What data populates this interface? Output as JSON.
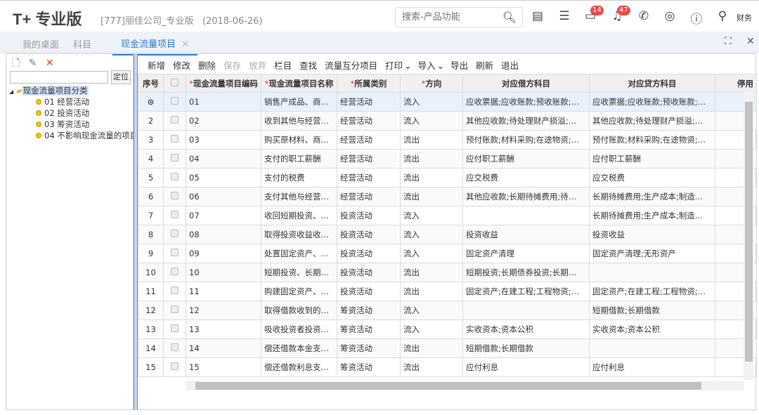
{
  "header": {
    "logo": "T+",
    "product": "专业版",
    "company": "[777]丽佳公司_专业版",
    "date": "(2018-06-26)",
    "search_placeholder": "搜索-产品功能",
    "badges": {
      "messages": "14",
      "notifications": "47"
    },
    "user": "财务"
  },
  "tabs": [
    {
      "label": "我的桌面"
    },
    {
      "label": "科目"
    },
    {
      "label": "现金流量项目"
    }
  ],
  "left": {
    "locate": "定位",
    "tree_root": "现金流量项目分类",
    "tree_items": [
      "01 经营活动",
      "02 投资活动",
      "03 筹资活动",
      "04 不影响现金流量的项目"
    ]
  },
  "toolbar": {
    "items": [
      "新增",
      "修改",
      "删除",
      "保存",
      "放弃",
      "栏目",
      "查找",
      "流量互分项目",
      "打印",
      "导入",
      "导出",
      "刷新",
      "退出"
    ]
  },
  "table": {
    "columns": [
      "序号",
      "",
      "现金流量项目编码",
      "现金流量项目名称",
      "所属类别",
      "方向",
      "对应借方科目",
      "对应贷方科目",
      "停用"
    ],
    "rows": [
      [
        "1",
        "01",
        "销售产成品、商品、提供劳务收到的现金",
        "经营活动",
        "流入",
        "应收票据;应收账款;预收账款;…",
        "应收票据;应收账款;预收账款;…"
      ],
      [
        "2",
        "02",
        "收到其他与经营活动有关的现金",
        "经营活动",
        "流入",
        "其他应收款;待处理财产损溢;…",
        "其他应收款;待处理财产损溢;…"
      ],
      [
        "3",
        "03",
        "购买原材料、商品、接受劳务支付的现金",
        "经营活动",
        "流出",
        "预付账款;材料采购;在途物资;…",
        "预付账款;材料采购;在途物资;…"
      ],
      [
        "4",
        "04",
        "支付的职工薪酬",
        "经营活动",
        "流出",
        "应付职工薪酬",
        "应付职工薪酬"
      ],
      [
        "5",
        "05",
        "支付的税费",
        "经营活动",
        "流出",
        "应交税费",
        "应交税费"
      ],
      [
        "6",
        "06",
        "支付其他与经营活动有关的现金",
        "经营活动",
        "流出",
        "其他应收款;长期待摊费用;待…",
        "长期待摊费用;生产成本;制造…"
      ],
      [
        "7",
        "07",
        "收回短期投资、…",
        "投资活动",
        "流入",
        "",
        "长期待摊费用;生产成本;制造…"
      ],
      [
        "8",
        "08",
        "取得投资收益收到的现金",
        "投资活动",
        "流入",
        "投资收益",
        "投资收益"
      ],
      [
        "9",
        "09",
        "处置固定资产、…",
        "投资活动",
        "流入",
        "固定资产清理",
        "固定资产清理;无形资产"
      ],
      [
        "10",
        "10",
        "短期投资、长期…",
        "投资活动",
        "流出",
        "短期投资;长期债券投资;长期…",
        ""
      ],
      [
        "11",
        "11",
        "购建固定资产、…",
        "投资活动",
        "流出",
        "固定资产;在建工程;工程物资;…",
        "固定资产;在建工程;工程物资;…"
      ],
      [
        "12",
        "12",
        "取得借款收到的现金",
        "筹资活动",
        "流入",
        "",
        "短期借款;长期借款"
      ],
      [
        "13",
        "13",
        "吸收投资者投资收到的现金",
        "筹资活动",
        "流入",
        "实收资本;资本公积",
        "实收资本;资本公积"
      ],
      [
        "14",
        "14",
        "偿还借款本金支付的现金",
        "筹资活动",
        "流出",
        "短期借款;长期借款",
        ""
      ],
      [
        "15",
        "15",
        "偿还借款利息支付的现金",
        "筹资活动",
        "流出",
        "应付利息",
        "应付利息"
      ]
    ]
  },
  "colors": {
    "accent": "#2a7bd4",
    "badge": "#e84a4a",
    "selected_row": "#e8f1fc"
  }
}
